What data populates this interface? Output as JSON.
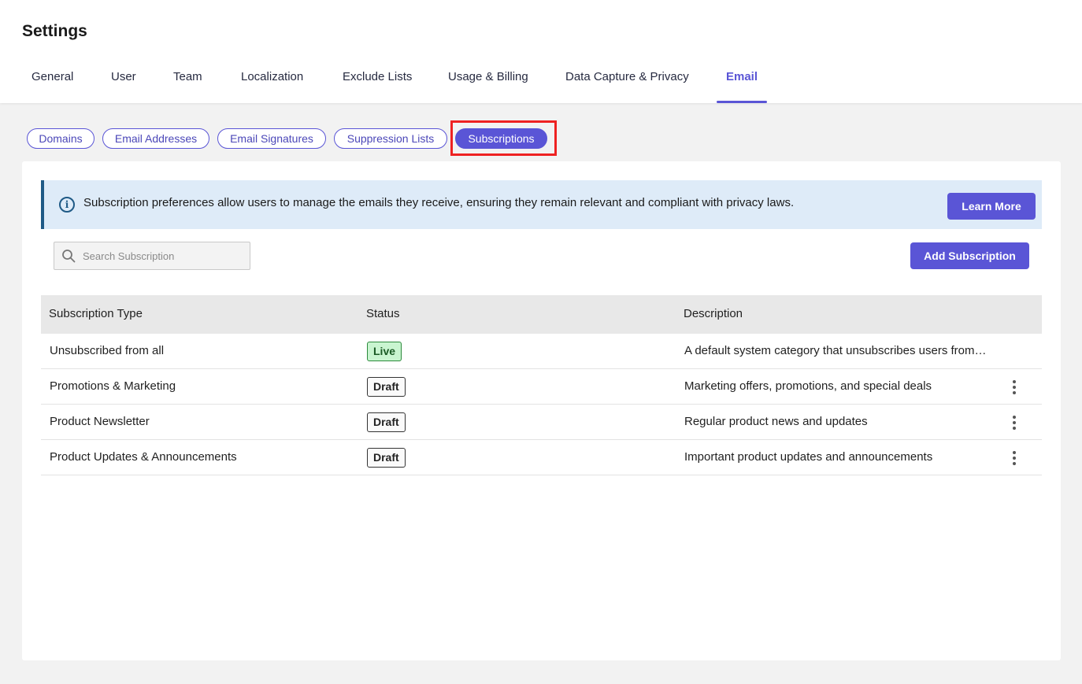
{
  "page": {
    "title": "Settings"
  },
  "tabs": [
    {
      "label": "General"
    },
    {
      "label": "User"
    },
    {
      "label": "Team"
    },
    {
      "label": "Localization"
    },
    {
      "label": "Exclude Lists"
    },
    {
      "label": "Usage & Billing"
    },
    {
      "label": "Data Capture & Privacy"
    },
    {
      "label": "Email",
      "active": true
    }
  ],
  "subtabs": [
    {
      "label": "Domains"
    },
    {
      "label": "Email Addresses"
    },
    {
      "label": "Email Signatures"
    },
    {
      "label": "Suppression Lists"
    },
    {
      "label": "Subscriptions",
      "active": true
    }
  ],
  "banner": {
    "text": "Subscription preferences allow users to manage the emails they receive, ensuring they remain relevant and compliant with privacy laws.",
    "button_label": "Learn More",
    "icon": "info-icon"
  },
  "search": {
    "placeholder": "Search Subscription",
    "value": "",
    "icon": "search-icon"
  },
  "add_button_label": "Add Subscription",
  "table": {
    "headers": [
      "Subscription Type",
      "Status",
      "Description"
    ],
    "rows": [
      {
        "type": "Unsubscribed from all",
        "status": "Live",
        "description": "A default system category that unsubscribes users from ...",
        "menu": false
      },
      {
        "type": "Promotions & Marketing",
        "status": "Draft",
        "description": "Marketing offers, promotions, and special deals",
        "menu": true
      },
      {
        "type": "Product Newsletter",
        "status": "Draft",
        "description": "Regular product news and updates",
        "menu": true
      },
      {
        "type": "Product Updates & Announcements",
        "status": "Draft",
        "description": "Important product updates and announcements",
        "menu": true
      }
    ]
  },
  "colors": {
    "accent": "#5a55d6",
    "banner_bg": "#deebf8",
    "live_badge": "#c9f5d0",
    "highlight": "#ee2222"
  }
}
